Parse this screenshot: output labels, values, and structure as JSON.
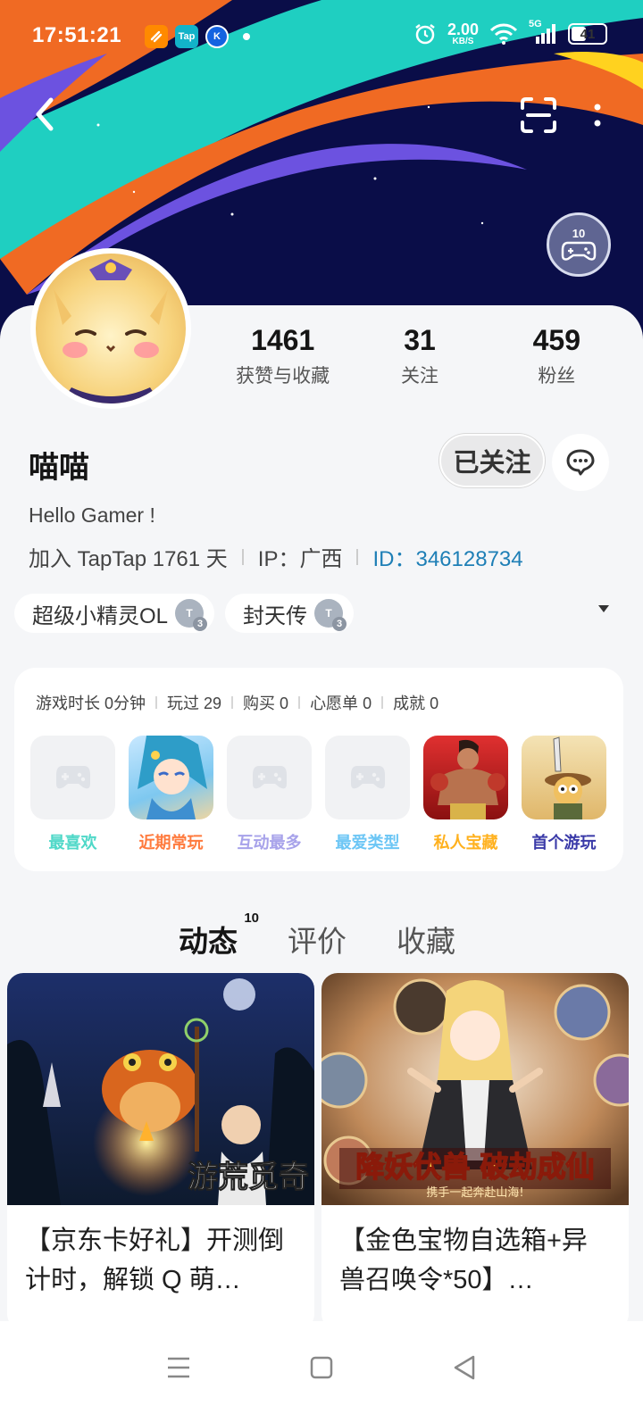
{
  "status_bar": {
    "time": "17:51:21",
    "apps": [
      {
        "name": "fliggy-icon",
        "label": "",
        "color": "#ff8a00"
      },
      {
        "name": "taptap-icon",
        "label": "Tap",
        "color": "#12b3c9"
      },
      {
        "name": "k-app-icon",
        "label": "K",
        "color": "#1463e0"
      }
    ],
    "speed_value": "2.00",
    "speed_unit": "KB/S",
    "network": "5G",
    "battery": "41"
  },
  "level_badge": {
    "level": "10"
  },
  "profile": {
    "name": "喵喵",
    "follow_label": "已关注",
    "bio": "Hello Gamer !",
    "joined": "加入 TapTap 1761 天",
    "ip": "IP：广西",
    "id": "ID：346128734"
  },
  "stats": [
    {
      "value": "1461",
      "label": "获赞与收藏"
    },
    {
      "value": "31",
      "label": "关注"
    },
    {
      "value": "459",
      "label": "粉丝"
    }
  ],
  "game_tags": [
    {
      "label": "超级小精灵OL",
      "badge": "3"
    },
    {
      "label": "封天传",
      "badge": "3"
    }
  ],
  "game_stats": [
    "游戏时长 0分钟",
    "玩过 29",
    "购买 0",
    "心愿单 0",
    "成就 0"
  ],
  "game_icons": [
    {
      "caption": "最喜欢",
      "color": "#4fd8c8",
      "empty": true
    },
    {
      "caption": "近期常玩",
      "color": "#ff7a3d",
      "empty": false
    },
    {
      "caption": "互动最多",
      "color": "#a7a2ea",
      "empty": true
    },
    {
      "caption": "最爱类型",
      "color": "#6cc6f5",
      "empty": true
    },
    {
      "caption": "私人宝藏",
      "color": "#ffb11e",
      "empty": false
    },
    {
      "caption": "首个游玩",
      "color": "#3a3aa8",
      "empty": false
    }
  ],
  "tabs": [
    {
      "label": "动态",
      "count": "10",
      "active": true
    },
    {
      "label": "评价",
      "count": "",
      "active": false
    },
    {
      "label": "收藏",
      "count": "",
      "active": false
    }
  ],
  "posts": [
    {
      "title": "【京东卡好礼】开测倒计时，解锁 Q 萌…",
      "cover_text": "游荒觅奇"
    },
    {
      "title": "【金色宝物自选箱+异兽召唤令*50】…",
      "cover_text": "降妖伏兽 破劫成仙",
      "cover_sub": "携手一起奔赴山海!"
    }
  ]
}
